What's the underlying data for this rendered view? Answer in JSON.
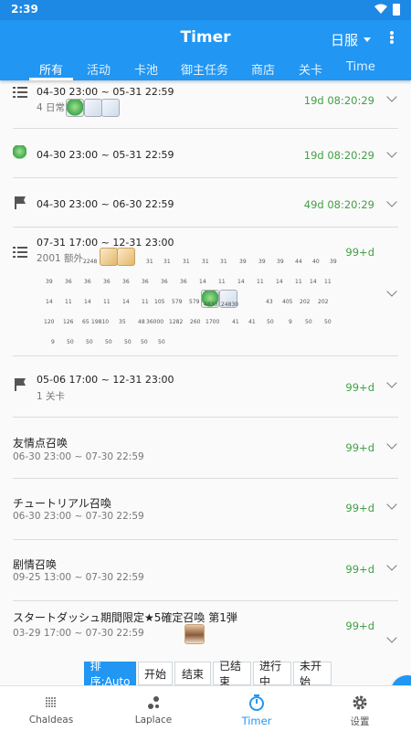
{
  "status": {
    "time": "2:39"
  },
  "appbar": {
    "title": "Timer",
    "region": "日服"
  },
  "tabs": [
    "所有",
    "活动",
    "卡池",
    "御主任务",
    "商店",
    "关卡",
    "Time"
  ],
  "items": [
    {
      "icon": "checklist-icon",
      "date": "04-30 23:00 ~ 05-31 22:59",
      "sub": "4 日常",
      "remain": "19d 08:20:29"
    },
    {
      "icon": "green-item-icon",
      "date": "04-30 23:00 ~ 05-31 22:59",
      "remain": "19d 08:20:29"
    },
    {
      "icon": "flag-icon",
      "date": "04-30 23:00 ~ 06-30 22:59",
      "remain": "49d 08:20:29"
    },
    {
      "icon": "checklist-icon",
      "date": "07-31 17:00 ~ 12-31 23:00",
      "sub": "2001 额外",
      "remain": "99+d",
      "grid": {
        "row0": [
          "2248",
          "31",
          "31",
          "31",
          "31",
          "31",
          "39",
          "39",
          "39",
          "44",
          "40",
          "39"
        ],
        "row1": [
          "39",
          "36",
          "36",
          "36",
          "36",
          "36",
          "36",
          "36",
          "14",
          "11",
          "14",
          "11",
          "14",
          "11",
          "14",
          "11"
        ],
        "row2": [
          "14",
          "11",
          "14",
          "11",
          "14",
          "11",
          "105",
          "579",
          "579",
          "4830",
          "24830",
          "",
          "43",
          "405",
          "202",
          "202"
        ],
        "row3": [
          "120",
          "126",
          "65",
          "19810",
          "35",
          "48",
          "36000",
          "1282",
          "260",
          "1700",
          "41",
          "41",
          "50",
          "9",
          "50",
          "50"
        ],
        "row4": [
          "9",
          "50",
          "50",
          "50",
          "50",
          "50",
          "50"
        ]
      }
    },
    {
      "icon": "flag-icon",
      "date": "05-06 17:00 ~ 12-31 23:00",
      "sub": "1 关卡",
      "remain": "99+d"
    },
    {
      "name": "友情点召唤",
      "period": "06-30 23:00 ~ 07-30 22:59",
      "remain": "99+d"
    },
    {
      "name": "チュートリアル召喚",
      "period": "06-30 23:00 ~ 07-30 22:59",
      "remain": "99+d"
    },
    {
      "name": "剧情召唤",
      "period": "09-25 13:00 ~ 07-30 22:59",
      "remain": "99+d"
    },
    {
      "name": "スタートダッシュ期間限定★5確定召喚 第1弾",
      "period": "03-29 17:00 ~ 07-30 22:59",
      "remain": "99+d"
    }
  ],
  "sort_buttons": [
    "排序:Auto",
    "开始",
    "结束",
    "已结束",
    "进行中",
    "未开始"
  ],
  "nav": [
    "Chaldeas",
    "Laplace",
    "Timer",
    "设置"
  ],
  "colors": {
    "primary": "#2196f3",
    "remain_green": "#43a047"
  }
}
